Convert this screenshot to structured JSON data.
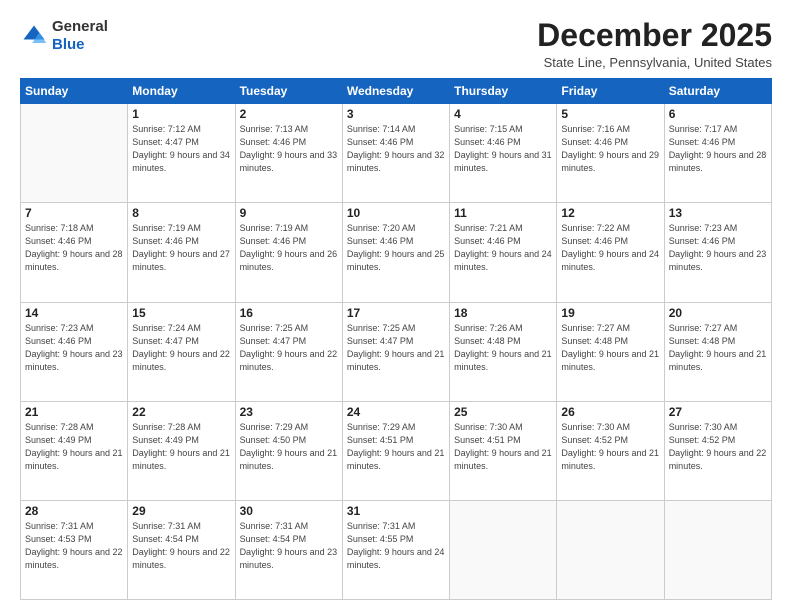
{
  "logo": {
    "general": "General",
    "blue": "Blue"
  },
  "header": {
    "month": "December 2025",
    "location": "State Line, Pennsylvania, United States"
  },
  "days_of_week": [
    "Sunday",
    "Monday",
    "Tuesday",
    "Wednesday",
    "Thursday",
    "Friday",
    "Saturday"
  ],
  "weeks": [
    [
      {
        "day": "",
        "sunrise": "",
        "sunset": "",
        "daylight": ""
      },
      {
        "day": "1",
        "sunrise": "Sunrise: 7:12 AM",
        "sunset": "Sunset: 4:47 PM",
        "daylight": "Daylight: 9 hours and 34 minutes."
      },
      {
        "day": "2",
        "sunrise": "Sunrise: 7:13 AM",
        "sunset": "Sunset: 4:46 PM",
        "daylight": "Daylight: 9 hours and 33 minutes."
      },
      {
        "day": "3",
        "sunrise": "Sunrise: 7:14 AM",
        "sunset": "Sunset: 4:46 PM",
        "daylight": "Daylight: 9 hours and 32 minutes."
      },
      {
        "day": "4",
        "sunrise": "Sunrise: 7:15 AM",
        "sunset": "Sunset: 4:46 PM",
        "daylight": "Daylight: 9 hours and 31 minutes."
      },
      {
        "day": "5",
        "sunrise": "Sunrise: 7:16 AM",
        "sunset": "Sunset: 4:46 PM",
        "daylight": "Daylight: 9 hours and 29 minutes."
      },
      {
        "day": "6",
        "sunrise": "Sunrise: 7:17 AM",
        "sunset": "Sunset: 4:46 PM",
        "daylight": "Daylight: 9 hours and 28 minutes."
      }
    ],
    [
      {
        "day": "7",
        "sunrise": "Sunrise: 7:18 AM",
        "sunset": "Sunset: 4:46 PM",
        "daylight": "Daylight: 9 hours and 28 minutes."
      },
      {
        "day": "8",
        "sunrise": "Sunrise: 7:19 AM",
        "sunset": "Sunset: 4:46 PM",
        "daylight": "Daylight: 9 hours and 27 minutes."
      },
      {
        "day": "9",
        "sunrise": "Sunrise: 7:19 AM",
        "sunset": "Sunset: 4:46 PM",
        "daylight": "Daylight: 9 hours and 26 minutes."
      },
      {
        "day": "10",
        "sunrise": "Sunrise: 7:20 AM",
        "sunset": "Sunset: 4:46 PM",
        "daylight": "Daylight: 9 hours and 25 minutes."
      },
      {
        "day": "11",
        "sunrise": "Sunrise: 7:21 AM",
        "sunset": "Sunset: 4:46 PM",
        "daylight": "Daylight: 9 hours and 24 minutes."
      },
      {
        "day": "12",
        "sunrise": "Sunrise: 7:22 AM",
        "sunset": "Sunset: 4:46 PM",
        "daylight": "Daylight: 9 hours and 24 minutes."
      },
      {
        "day": "13",
        "sunrise": "Sunrise: 7:23 AM",
        "sunset": "Sunset: 4:46 PM",
        "daylight": "Daylight: 9 hours and 23 minutes."
      }
    ],
    [
      {
        "day": "14",
        "sunrise": "Sunrise: 7:23 AM",
        "sunset": "Sunset: 4:46 PM",
        "daylight": "Daylight: 9 hours and 23 minutes."
      },
      {
        "day": "15",
        "sunrise": "Sunrise: 7:24 AM",
        "sunset": "Sunset: 4:47 PM",
        "daylight": "Daylight: 9 hours and 22 minutes."
      },
      {
        "day": "16",
        "sunrise": "Sunrise: 7:25 AM",
        "sunset": "Sunset: 4:47 PM",
        "daylight": "Daylight: 9 hours and 22 minutes."
      },
      {
        "day": "17",
        "sunrise": "Sunrise: 7:25 AM",
        "sunset": "Sunset: 4:47 PM",
        "daylight": "Daylight: 9 hours and 21 minutes."
      },
      {
        "day": "18",
        "sunrise": "Sunrise: 7:26 AM",
        "sunset": "Sunset: 4:48 PM",
        "daylight": "Daylight: 9 hours and 21 minutes."
      },
      {
        "day": "19",
        "sunrise": "Sunrise: 7:27 AM",
        "sunset": "Sunset: 4:48 PM",
        "daylight": "Daylight: 9 hours and 21 minutes."
      },
      {
        "day": "20",
        "sunrise": "Sunrise: 7:27 AM",
        "sunset": "Sunset: 4:48 PM",
        "daylight": "Daylight: 9 hours and 21 minutes."
      }
    ],
    [
      {
        "day": "21",
        "sunrise": "Sunrise: 7:28 AM",
        "sunset": "Sunset: 4:49 PM",
        "daylight": "Daylight: 9 hours and 21 minutes."
      },
      {
        "day": "22",
        "sunrise": "Sunrise: 7:28 AM",
        "sunset": "Sunset: 4:49 PM",
        "daylight": "Daylight: 9 hours and 21 minutes."
      },
      {
        "day": "23",
        "sunrise": "Sunrise: 7:29 AM",
        "sunset": "Sunset: 4:50 PM",
        "daylight": "Daylight: 9 hours and 21 minutes."
      },
      {
        "day": "24",
        "sunrise": "Sunrise: 7:29 AM",
        "sunset": "Sunset: 4:51 PM",
        "daylight": "Daylight: 9 hours and 21 minutes."
      },
      {
        "day": "25",
        "sunrise": "Sunrise: 7:30 AM",
        "sunset": "Sunset: 4:51 PM",
        "daylight": "Daylight: 9 hours and 21 minutes."
      },
      {
        "day": "26",
        "sunrise": "Sunrise: 7:30 AM",
        "sunset": "Sunset: 4:52 PM",
        "daylight": "Daylight: 9 hours and 21 minutes."
      },
      {
        "day": "27",
        "sunrise": "Sunrise: 7:30 AM",
        "sunset": "Sunset: 4:52 PM",
        "daylight": "Daylight: 9 hours and 22 minutes."
      }
    ],
    [
      {
        "day": "28",
        "sunrise": "Sunrise: 7:31 AM",
        "sunset": "Sunset: 4:53 PM",
        "daylight": "Daylight: 9 hours and 22 minutes."
      },
      {
        "day": "29",
        "sunrise": "Sunrise: 7:31 AM",
        "sunset": "Sunset: 4:54 PM",
        "daylight": "Daylight: 9 hours and 22 minutes."
      },
      {
        "day": "30",
        "sunrise": "Sunrise: 7:31 AM",
        "sunset": "Sunset: 4:54 PM",
        "daylight": "Daylight: 9 hours and 23 minutes."
      },
      {
        "day": "31",
        "sunrise": "Sunrise: 7:31 AM",
        "sunset": "Sunset: 4:55 PM",
        "daylight": "Daylight: 9 hours and 24 minutes."
      },
      {
        "day": "",
        "sunrise": "",
        "sunset": "",
        "daylight": ""
      },
      {
        "day": "",
        "sunrise": "",
        "sunset": "",
        "daylight": ""
      },
      {
        "day": "",
        "sunrise": "",
        "sunset": "",
        "daylight": ""
      }
    ]
  ]
}
